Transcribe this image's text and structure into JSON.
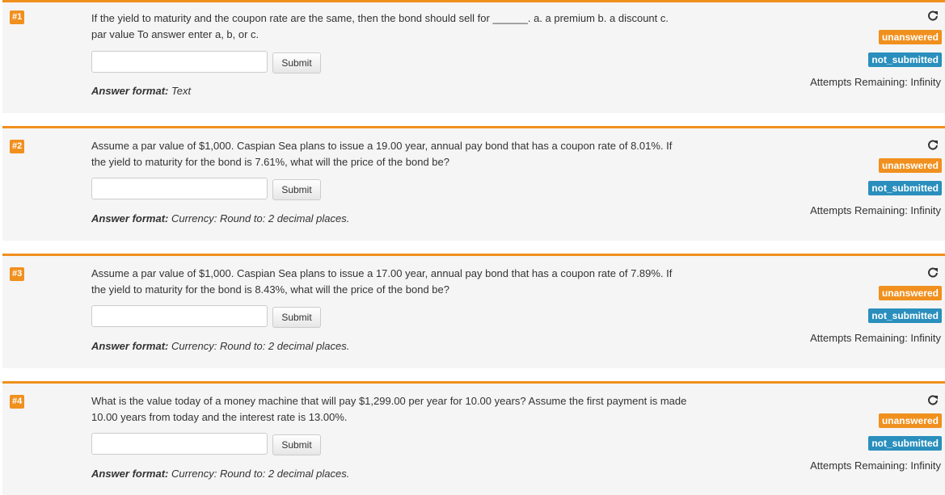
{
  "questions": [
    {
      "number": "#1",
      "text": "If the yield to maturity and the coupon rate are the same, then the bond should sell for ______. a. a premium b. a discount c. par value To answer enter a, b, or c.",
      "input_value": "",
      "submit_label": "Submit",
      "format_label": "Answer format:",
      "format_value": "Text",
      "status_answer": "unanswered",
      "status_submit": "not_submitted",
      "attempts": "Attempts Remaining: Infinity",
      "redo_icon": "redo-icon"
    },
    {
      "number": "#2",
      "text": "Assume a par value of $1,000. Caspian Sea plans to issue a 19.00 year, annual pay bond that has a coupon rate of 8.01%. If the yield to maturity for the bond is 7.61%, what will the price of the bond be?",
      "input_value": "",
      "submit_label": "Submit",
      "format_label": "Answer format:",
      "format_value": "Currency: Round to: 2 decimal places.",
      "status_answer": "unanswered",
      "status_submit": "not_submitted",
      "attempts": "Attempts Remaining: Infinity",
      "redo_icon": "redo-icon"
    },
    {
      "number": "#3",
      "text": "Assume a par value of $1,000. Caspian Sea plans to issue a 17.00 year, annual pay bond that has a coupon rate of 7.89%. If the yield to maturity for the bond is 8.43%, what will the price of the bond be?",
      "input_value": "",
      "submit_label": "Submit",
      "format_label": "Answer format:",
      "format_value": "Currency: Round to: 2 decimal places.",
      "status_answer": "unanswered",
      "status_submit": "not_submitted",
      "attempts": "Attempts Remaining: Infinity",
      "redo_icon": "redo-icon"
    },
    {
      "number": "#4",
      "text": "What is the value today of a money machine that will pay $1,299.00 per year for 10.00 years? Assume the first payment is made 10.00 years from today and the interest rate is 13.00%.",
      "input_value": "",
      "submit_label": "Submit",
      "format_label": "Answer format:",
      "format_value": "Currency: Round to: 2 decimal places.",
      "status_answer": "unanswered",
      "status_submit": "not_submitted",
      "attempts": "Attempts Remaining: Infinity",
      "redo_icon": "redo-icon"
    }
  ],
  "colors": {
    "accent_orange": "#f0901e",
    "status_blue": "#2a8fbd",
    "panel_bg": "#f5f5f5"
  }
}
